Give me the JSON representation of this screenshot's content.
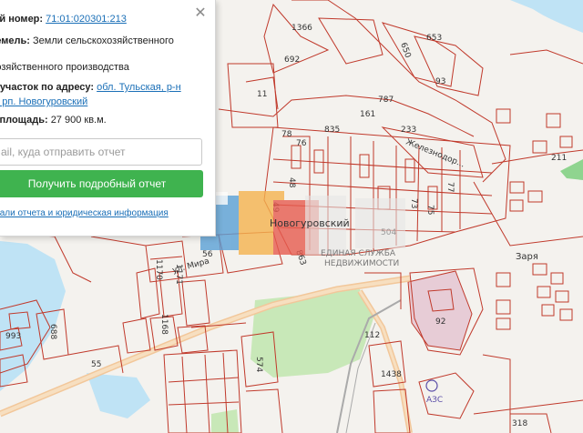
{
  "panel": {
    "cadastral_label": "ый номер:",
    "cadastral_number": "71:01:020301:213",
    "land_category_label": "земель:",
    "land_category_value": "Земли сельскохозяйственного",
    "land_use": "хозяйственного производства",
    "address_label": "й участок по адресу:",
    "address_link_1": "обл. Тульская, р-н",
    "address_link_2": "й, рп. Новогуровский",
    "area_label": "я площадь:",
    "area_value": "27 900 кв.м.",
    "email_placeholder": "ail, куда отправить отчет",
    "get_report_button": "Получить подробный отчет",
    "details_link": "етали отчета и юридическая информация",
    "close_symbol": "✕"
  },
  "watermark": {
    "place": "Новогуровский",
    "brand_line1": "ЕДИНАЯ СЛУЖБА",
    "brand_line2": "НЕДВИЖИМОСТИ"
  },
  "map_labels": [
    {
      "id": "lbl-1366",
      "text": "1366"
    },
    {
      "id": "lbl-653",
      "text": "653"
    },
    {
      "id": "lbl-692",
      "text": "692"
    },
    {
      "id": "lbl-650",
      "text": "650"
    },
    {
      "id": "lbl-93",
      "text": "93"
    },
    {
      "id": "lbl-11",
      "text": "11"
    },
    {
      "id": "lbl-787",
      "text": "787"
    },
    {
      "id": "lbl-161",
      "text": "161"
    },
    {
      "id": "lbl-233",
      "text": "233"
    },
    {
      "id": "lbl-78",
      "text": "78"
    },
    {
      "id": "lbl-76",
      "text": "76"
    },
    {
      "id": "lbl-835",
      "text": "835"
    },
    {
      "id": "lbl-48",
      "text": "48"
    },
    {
      "id": "lbl-49",
      "text": "49"
    },
    {
      "id": "lbl-56",
      "text": "56"
    },
    {
      "id": "lbl-863",
      "text": "863"
    },
    {
      "id": "lbl-504",
      "text": "504"
    },
    {
      "id": "lbl-73",
      "text": "73"
    },
    {
      "id": "lbl-75",
      "text": "75"
    },
    {
      "id": "lbl-77",
      "text": "77"
    },
    {
      "id": "lbl-211",
      "text": "211"
    },
    {
      "id": "lbl-92",
      "text": "92"
    },
    {
      "id": "lbl-112",
      "text": "112"
    },
    {
      "id": "lbl-1438",
      "text": "1438"
    },
    {
      "id": "lbl-318",
      "text": "318"
    },
    {
      "id": "lbl-1170",
      "text": "1170"
    },
    {
      "id": "lbl-1171",
      "text": "1171"
    },
    {
      "id": "lbl-1168",
      "text": "1168"
    },
    {
      "id": "lbl-993",
      "text": "993"
    },
    {
      "id": "lbl-688",
      "text": "688"
    },
    {
      "id": "lbl-55",
      "text": "55"
    },
    {
      "id": "lbl-574",
      "text": "574"
    },
    {
      "id": "lbl-zarya",
      "text": "Заря"
    },
    {
      "id": "lbl-azs",
      "text": "АЗС"
    }
  ],
  "streets": {
    "zheleznodor": "Железнодор...",
    "mira": "ул. Мира"
  },
  "colors": {
    "cadastral_line": "#c0392b",
    "button_green": "#3fb34f",
    "link_blue": "#1a6fb7",
    "water": "#bfe3f5",
    "forest": "#c8e8b8"
  }
}
